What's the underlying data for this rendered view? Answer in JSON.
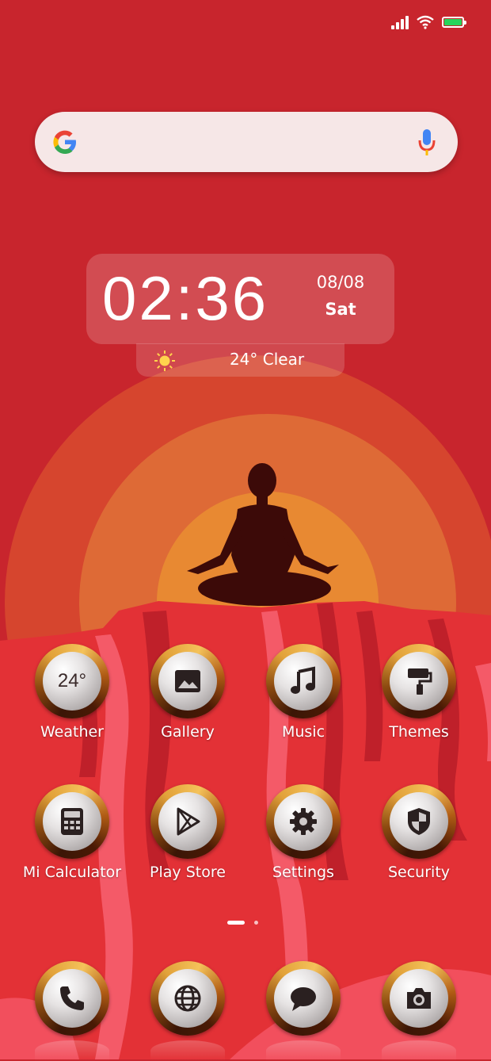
{
  "status_bar": {
    "signal_icon": "signal-bars-icon",
    "wifi_icon": "wifi-icon",
    "battery_icon": "battery-icon",
    "battery_color": "#27d45b"
  },
  "search_bar": {
    "logo_icon": "google-g-icon",
    "mic_icon": "mic-icon"
  },
  "clock_widget": {
    "time": "02:36",
    "date": "08/08",
    "day": "Sat"
  },
  "weather_widget": {
    "icon": "sun-icon",
    "text": "24° Clear"
  },
  "apps_row1": [
    {
      "label": "Weather",
      "icon": "weather-icon",
      "badge": "24°"
    },
    {
      "label": "Gallery",
      "icon": "gallery-icon"
    },
    {
      "label": "Music",
      "icon": "music-icon"
    },
    {
      "label": "Themes",
      "icon": "themes-icon"
    }
  ],
  "apps_row2": [
    {
      "label": "Mi Calculator",
      "icon": "calculator-icon"
    },
    {
      "label": "Play Store",
      "icon": "play-store-icon"
    },
    {
      "label": "Settings",
      "icon": "settings-icon"
    },
    {
      "label": "Security",
      "icon": "security-icon"
    }
  ],
  "dock": [
    {
      "icon": "phone-icon"
    },
    {
      "icon": "browser-icon"
    },
    {
      "icon": "messages-icon"
    },
    {
      "icon": "camera-icon"
    }
  ],
  "page_indicator": {
    "pages": 2,
    "current": 1
  },
  "colors": {
    "background": "#c8252d",
    "sun_outer": "#d2402c",
    "sun_mid": "#e0663a",
    "sun_inner": "#e98a34",
    "cliff": "#e53238"
  }
}
